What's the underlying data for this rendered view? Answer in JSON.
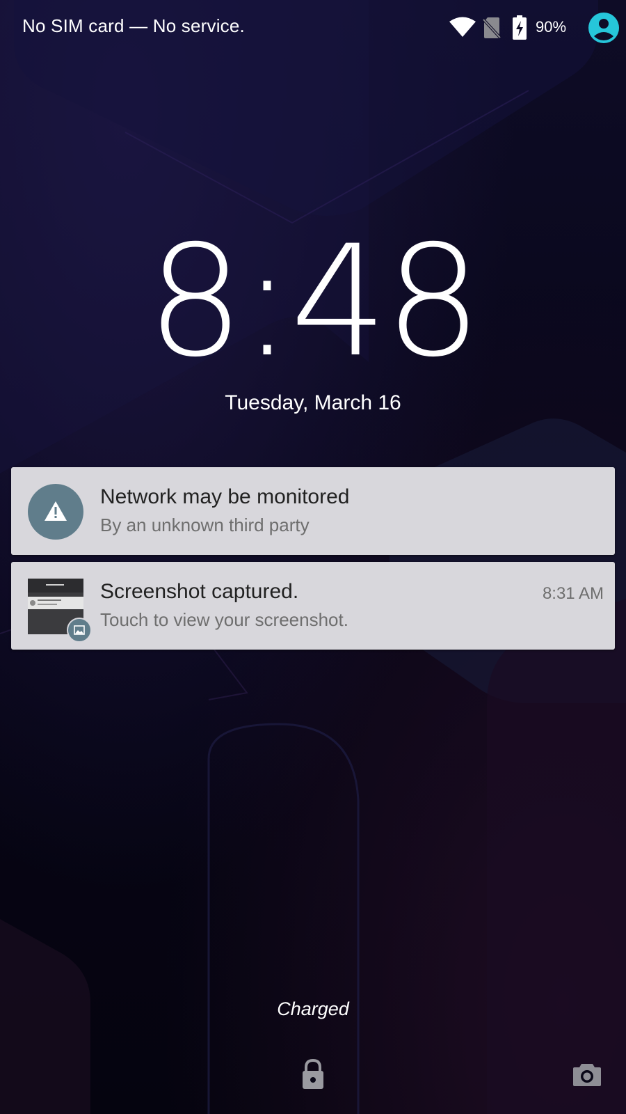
{
  "status_bar": {
    "carrier_text": "No SIM card — No service.",
    "battery_percent": "90%",
    "icons": [
      "wifi-icon",
      "no-sim-icon",
      "battery-charging-icon",
      "user-avatar-icon"
    ],
    "avatar_color": "#26c6da"
  },
  "clock": {
    "time": "8:48",
    "date": "Tuesday, March 16"
  },
  "notifications": [
    {
      "title": "Network may be monitored",
      "text": "By an unknown third party",
      "icon": "warning-icon",
      "icon_bg": "#607d8b"
    },
    {
      "title": "Screenshot captured.",
      "text": "Touch to view your screenshot.",
      "time": "8:31 AM",
      "icon": "screenshot-thumbnail",
      "badge_icon": "image-icon"
    }
  ],
  "charging_status": "Charged",
  "bottom_actions": {
    "left": "lock-icon",
    "right": "camera-icon"
  },
  "colors": {
    "notification_bg": "#d8d7dc",
    "accent": "#26c6da"
  }
}
